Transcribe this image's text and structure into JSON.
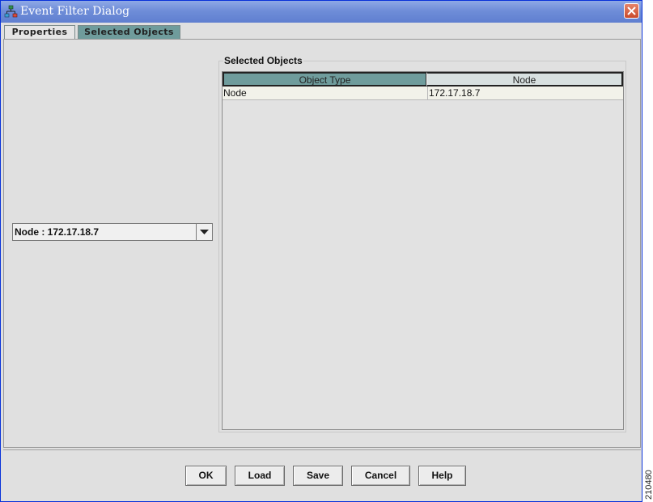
{
  "window": {
    "title": "Event Filter Dialog",
    "icon": "app-tree-icon",
    "close_icon": "close-icon"
  },
  "tabs": [
    {
      "label": "Properties",
      "active": false
    },
    {
      "label": "Selected Objects",
      "active": true
    }
  ],
  "left": {
    "combo": {
      "value": "Node : 172.17.18.7",
      "icon": "chevron-down-icon"
    }
  },
  "selected_objects": {
    "group_label": "Selected Objects",
    "columns": [
      "Object Type",
      "Node"
    ],
    "rows": [
      [
        "Node",
        "172.17.18.7"
      ]
    ]
  },
  "buttons": {
    "ok": "OK",
    "load": "Load",
    "save": "Save",
    "cancel": "Cancel",
    "help": "Help"
  },
  "figure_id": "210480",
  "colors": {
    "title_bar": "#6f8dd8",
    "active_tab": "#6f9c9c",
    "panel_bg": "#e0e0e0"
  }
}
